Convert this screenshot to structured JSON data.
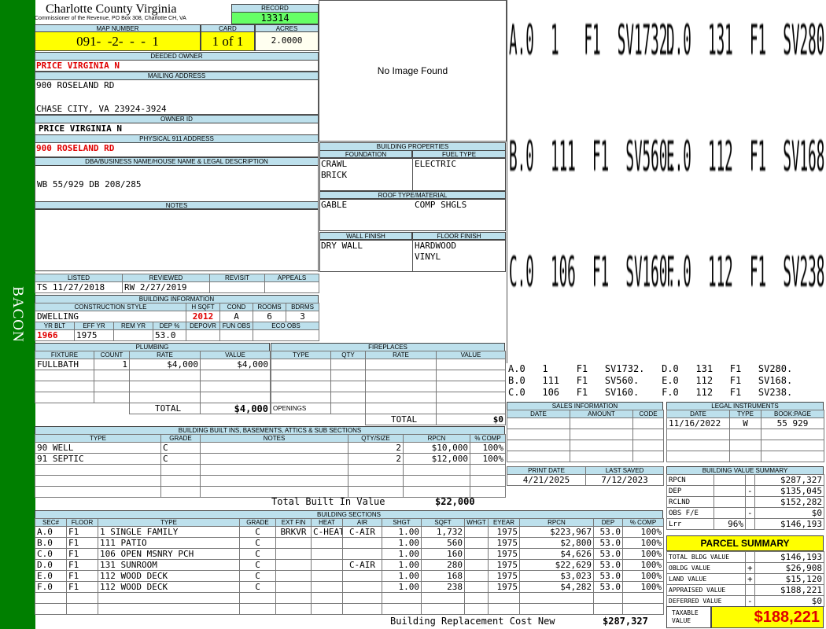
{
  "sidebar": {
    "label": "BACON"
  },
  "header": {
    "county": "Charlotte County Virginia",
    "subtitle": "Commissioner of the Revenue, PO Box 308, Charlotte CH, VA",
    "record_label": "RECORD",
    "record_value": "13314",
    "map_label": "MAP NUMBER",
    "map_value": "091-  -2-  -  -  1",
    "card_label": "CARD",
    "card_value": "1 of 1",
    "acres_label": "ACRES",
    "acres_value": "2.0000"
  },
  "owner": {
    "deeded_label": "DEEDED OWNER",
    "deeded_value": "PRICE VIRGINIA N",
    "mailing_label": "MAILING ADDRESS",
    "mailing_line1": "900 ROSELAND RD",
    "mailing_line2": "CHASE CITY, VA 23924-3924",
    "owner_id_label": "OWNER ID",
    "owner_id_value": "PRICE VIRGINIA N",
    "address_label": "PHYSICAL 911 ADDRESS",
    "address_value": "900 ROSELAND RD",
    "dba_label": "DBA/BUSINESS NAME/HOUSE NAME & LEGAL DESCRIPTION",
    "dba_value": "WB 55/929 DB 208/285",
    "notes_label": "NOTES"
  },
  "image": {
    "placeholder": "No Image Found"
  },
  "building_props": {
    "title": "BUILDING PROPERTIES",
    "foundation_label": "FOUNDATION",
    "foundation": [
      "CRAWL",
      "BRICK"
    ],
    "fuel_label": "FUEL TYPE",
    "fuel": "ELECTRIC",
    "roof_label": "ROOF TYPE/MATERIAL",
    "roof_type": "GABLE",
    "roof_material": "COMP SHGLS",
    "wall_label": "WALL FINISH",
    "wall": "DRY WALL",
    "floor_label": "FLOOR FINISH",
    "floor": [
      "HARDWOOD",
      "VINYL"
    ]
  },
  "sketch": {
    "big_rows": [
      [
        "A.0  1   F1  SV1732.",
        "D.0  131  F1  SV280."
      ],
      [
        "B.0  111  F1  SV560.",
        "E.0  112  F1  SV168."
      ],
      [
        "C.0  106  F1  SV160.",
        "F.0  112  F1  SV238."
      ]
    ],
    "legend": [
      "A.0   1     F1   SV1732.   D.0   131   F1   SV280.",
      "B.0   111   F1   SV560.    E.0   112   F1   SV168.",
      "C.0   106   F1   SV160.    F.0   112   F1   SV238."
    ]
  },
  "dates": {
    "listed_label": "LISTED",
    "listed_by": "TS",
    "listed_date": "11/27/2018",
    "reviewed_label": "REVIEWED",
    "reviewed_by": "RW",
    "reviewed_date": "2/27/2019",
    "revisit_label": "REVISIT",
    "appeals_label": "APPEALS"
  },
  "building_info": {
    "title": "BUILDING INFORMATION",
    "style_label": "CONSTRUCTION STYLE",
    "style": "DWELLING",
    "hsqft_label": "H SQFT",
    "hsqft": "2012",
    "cond_label": "COND",
    "cond": "A",
    "rooms_label": "ROOMS",
    "rooms": "6",
    "bdrms_label": "BDRMS",
    "bdrms": "3",
    "yrblt_label": "YR BLT",
    "yrblt": "1966",
    "effyr_label": "EFF YR",
    "effyr": "1975",
    "remyr_label": "REM YR",
    "remyr": "",
    "dep_label": "DEP %",
    "dep": "53.0",
    "depovr_label": "DEPOVR",
    "funobs_label": "FUN OBS",
    "ecoobs_label": "ECO OBS"
  },
  "plumbing": {
    "title": "PLUMBING",
    "cols": [
      "FIXTURE",
      "COUNT",
      "RATE",
      "VALUE"
    ],
    "rows": [
      [
        "FULLBATH",
        "1",
        "$4,000",
        "$4,000"
      ]
    ],
    "total_label": "TOTAL",
    "total": "$4,000"
  },
  "fireplaces": {
    "title": "FIREPLACES",
    "cols": [
      "TYPE",
      "QTY",
      "RATE",
      "VALUE"
    ],
    "openings_label": "OPENINGS",
    "total_label": "TOTAL",
    "total": "$0"
  },
  "builtins": {
    "title": "BUILDING BUILT INS, BASEMENTS, ATTICS & SUB SECTIONS",
    "cols": [
      "TYPE",
      "GRADE",
      "NOTES",
      "QTY/SIZE",
      "RPCN",
      "% COMP"
    ],
    "rows": [
      [
        "90 WELL",
        "C",
        "",
        "2",
        "$10,000",
        "100%"
      ],
      [
        "91 SEPTIC",
        "C",
        "",
        "2",
        "$12,000",
        "100%"
      ]
    ],
    "total_label": "Total Built In Value",
    "total": "$22,000"
  },
  "sales": {
    "title": "SALES INFORMATION",
    "cols": [
      "DATE",
      "AMOUNT",
      "CODE"
    ]
  },
  "legal": {
    "title": "LEGAL INSTRUMENTS",
    "cols": [
      "DATE",
      "TYPE",
      "BOOK:PAGE"
    ],
    "rows": [
      [
        "11/16/2022",
        "W",
        "55 929"
      ]
    ]
  },
  "print": {
    "print_label": "PRINT DATE",
    "print_date": "4/21/2025",
    "saved_label": "LAST SAVED",
    "saved_date": "7/12/2023"
  },
  "value_summary": {
    "title": "BUILDING VALUE SUMMARY",
    "rows": [
      {
        "label": "RPCN",
        "pct": "",
        "sign": "",
        "value": "$287,327"
      },
      {
        "label": "DEP",
        "pct": "",
        "sign": "-",
        "value": "$135,045"
      },
      {
        "label": "RCLND",
        "pct": "",
        "sign": "",
        "value": "$152,282"
      },
      {
        "label": "OBS F/E",
        "pct": "",
        "sign": "-",
        "value": "$0"
      },
      {
        "label": "Lrr",
        "pct": "96%",
        "sign": "",
        "value": "$146,193"
      }
    ]
  },
  "parcel_summary": {
    "title": "PARCEL SUMMARY",
    "rows": [
      {
        "label": "TOTAL BLDG VALUE",
        "sign": "",
        "value": "$146,193"
      },
      {
        "label": "OBLDG VALUE",
        "sign": "+",
        "value": "$26,908"
      },
      {
        "label": "LAND VALUE",
        "sign": "+",
        "value": "$15,120"
      },
      {
        "label": "APPRAISED VALUE",
        "sign": "",
        "value": "$188,221"
      },
      {
        "label": "DEFERRED VALUE",
        "sign": "-",
        "value": "$0"
      }
    ],
    "taxable_label_1": "TAXABLE",
    "taxable_label_2": "VALUE",
    "taxable_value": "$188,221"
  },
  "sections": {
    "title": "BUILDING SECTIONS",
    "cols": [
      "SEC#",
      "FLOOR",
      "TYPE",
      "GRADE",
      "EXT FIN",
      "HEAT",
      "AIR",
      "SHGT",
      "SQFT",
      "WHGT",
      "EYEAR",
      "RPCN",
      "DEP",
      "% COMP"
    ],
    "rows": [
      [
        "A.0",
        "F1",
        "  1 SINGLE FAMILY",
        "C",
        "BRKVR",
        "C-HEAT",
        "C-AIR",
        "1.00",
        "1,732",
        "",
        "1975",
        "$223,967",
        "53.0",
        "100%"
      ],
      [
        "B.0",
        "F1",
        "111 PATIO",
        "C",
        "",
        "",
        "",
        "1.00",
        "560",
        "",
        "1975",
        "$2,800",
        "53.0",
        "100%"
      ],
      [
        "C.0",
        "F1",
        "106 OPEN MSNRY PCH",
        "C",
        "",
        "",
        "",
        "1.00",
        "160",
        "",
        "1975",
        "$4,626",
        "53.0",
        "100%"
      ],
      [
        "D.0",
        "F1",
        "131 SUNROOM",
        "C",
        "",
        "",
        "C-AIR",
        "1.00",
        "280",
        "",
        "1975",
        "$22,629",
        "53.0",
        "100%"
      ],
      [
        "E.0",
        "F1",
        "112 WOOD DECK",
        "C",
        "",
        "",
        "",
        "1.00",
        "168",
        "",
        "1975",
        "$3,023",
        "53.0",
        "100%"
      ],
      [
        "F.0",
        "F1",
        "112 WOOD DECK",
        "C",
        "",
        "",
        "",
        "1.00",
        "238",
        "",
        "1975",
        "$4,282",
        "53.0",
        "100%"
      ]
    ],
    "total_label": "Building Replacement Cost New",
    "total": "$287,327"
  }
}
